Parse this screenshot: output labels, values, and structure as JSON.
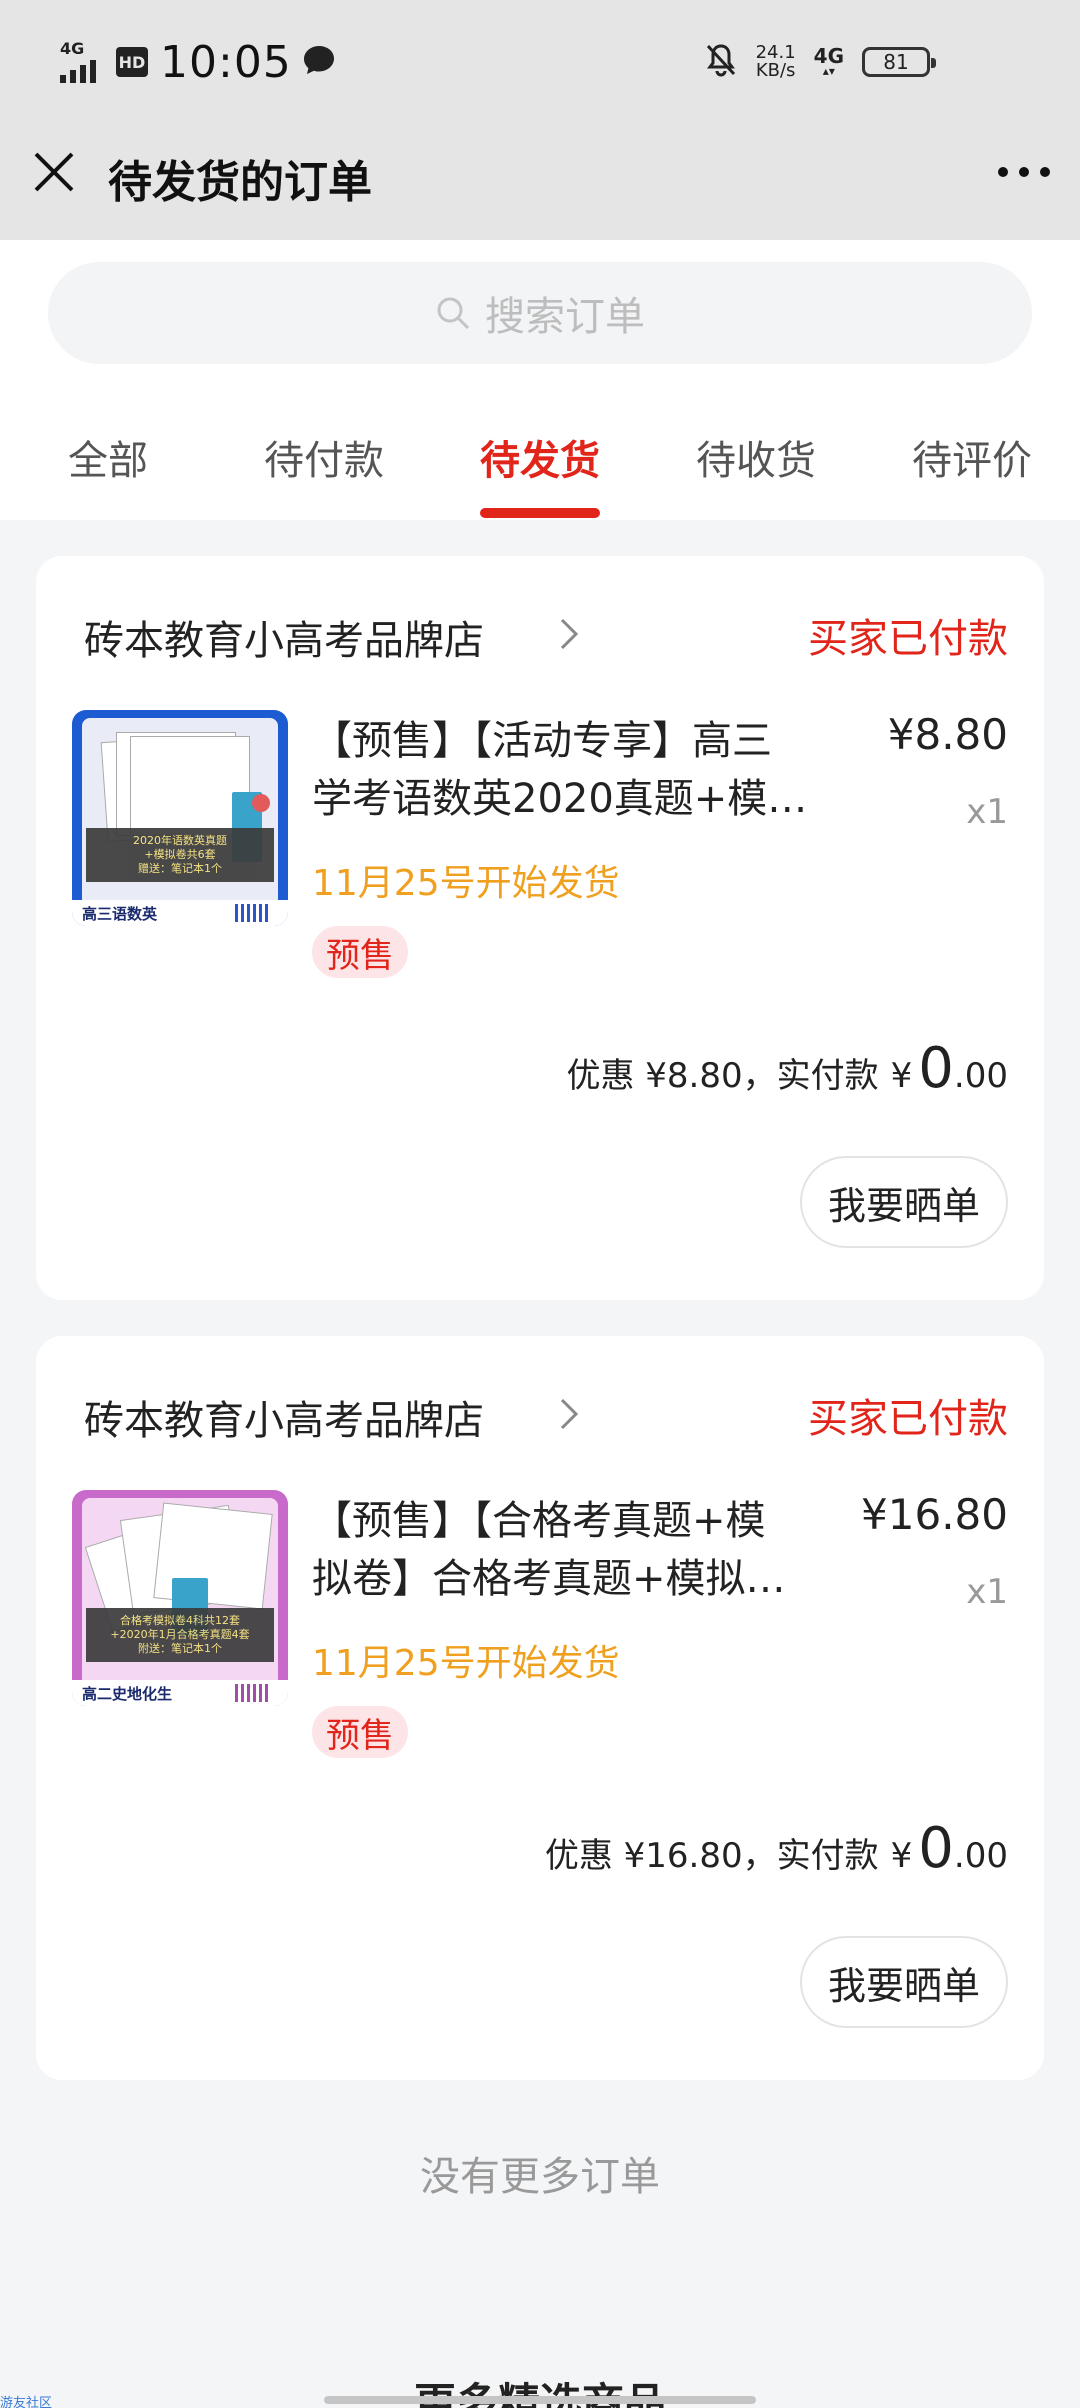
{
  "status_bar": {
    "network_left": "4G",
    "hd_label": "HD",
    "time": "10:05",
    "speed_value": "24.1",
    "speed_unit": "KB/s",
    "network_right": "4G",
    "battery": "81"
  },
  "header": {
    "title": "待发货的订单"
  },
  "search": {
    "placeholder": "搜索订单"
  },
  "tabs": [
    {
      "label": "全部",
      "active": false
    },
    {
      "label": "待付款",
      "active": false
    },
    {
      "label": "待发货",
      "active": true
    },
    {
      "label": "待收货",
      "active": false
    },
    {
      "label": "待评价",
      "active": false
    }
  ],
  "orders": [
    {
      "shop": "砖本教育小高考品牌店",
      "status": "买家已付款",
      "title_line1": "【预售】【活动专享】高三",
      "title_line2": "学考语数英2020真题+模…",
      "price": "¥8.80",
      "qty": "x1",
      "ship_note": "11月25号开始发货",
      "badge": "预售",
      "discount_text": "优惠 ¥8.80，实付款",
      "pay_yen": "¥",
      "pay_int": "0",
      "pay_dec": ".00",
      "share_label": "我要晒单",
      "thumb": {
        "band_line1": "2020年语数英真题",
        "band_line2": "+模拟卷共6套",
        "band_line3": "赠送：笔记本1个",
        "footer": "高三语数英"
      }
    },
    {
      "shop": "砖本教育小高考品牌店",
      "status": "买家已付款",
      "title_line1": "【预售】【合格考真题+模",
      "title_line2": "拟卷】合格考真题+模拟…",
      "price": "¥16.80",
      "qty": "x1",
      "ship_note": "11月25号开始发货",
      "badge": "预售",
      "discount_text": "优惠 ¥16.80，实付款",
      "pay_yen": "¥",
      "pay_int": "0",
      "pay_dec": ".00",
      "share_label": "我要晒单",
      "thumb": {
        "band_line1": "合格考模拟卷4科共12套",
        "band_line2": "+2020年1月合格考真题4套",
        "band_line3": "附送：笔记本1个",
        "footer": "高二史地化生"
      }
    }
  ],
  "footer": {
    "no_more": "没有更多订单",
    "more_goods": "更多精选商品",
    "watermark": "游友社区"
  },
  "colors": {
    "accent": "#e1251b",
    "ship_note": "#f0a020",
    "badge_bg": "#fde4e7"
  },
  "icons": [
    "close-icon",
    "more-dots-icon",
    "search-icon",
    "chevron-right-icon",
    "message-icon",
    "mute-bell-icon"
  ]
}
